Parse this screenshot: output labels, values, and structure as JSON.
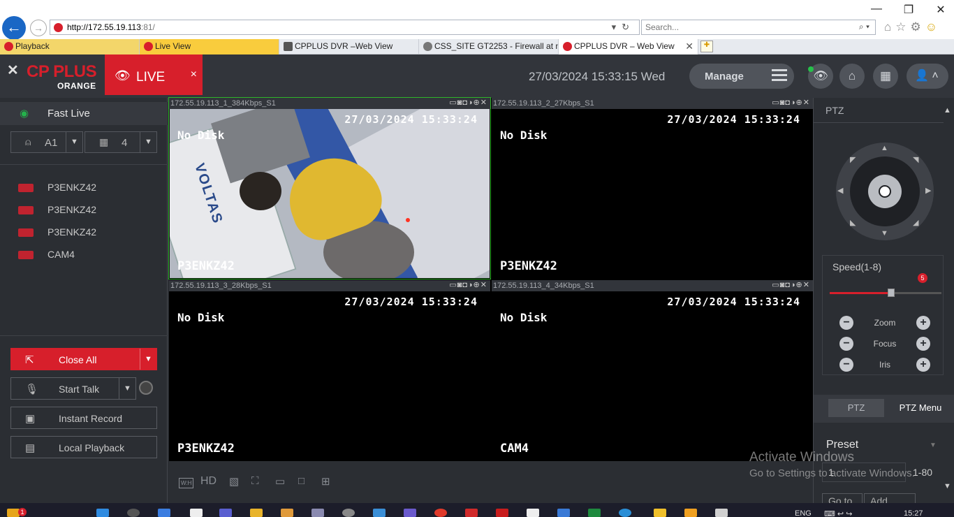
{
  "browser": {
    "url_host": "http://172.55.19.113",
    "url_rest": ":81/",
    "search_placeholder": "Search...",
    "tabs": [
      {
        "label": "Playback"
      },
      {
        "label": "Live View"
      },
      {
        "label": "CPPLUS DVR –Web View"
      },
      {
        "label": "CSS_SITE GT2253 - Firewall at n..."
      },
      {
        "label": "CPPLUS DVR – Web View"
      }
    ]
  },
  "header": {
    "brand_name": "CP PLUS",
    "brand_sub": "ORANGE",
    "live_label": "LIVE",
    "live_close": "×",
    "datetime": "27/03/2024 15:33:15 Wed",
    "manage_label": "Manage"
  },
  "sidebar": {
    "fast_live": "Fast Live",
    "area_select": "A1",
    "split_select": "4",
    "channels": [
      {
        "name": "P3ENKZ42"
      },
      {
        "name": "P3ENKZ42"
      },
      {
        "name": "P3ENKZ42"
      },
      {
        "name": "CAM4"
      }
    ],
    "close_all": "Close All",
    "start_talk": "Start Talk",
    "instant_record": "Instant Record",
    "local_playback": "Local Playback"
  },
  "video": {
    "panes": [
      {
        "title": "172.55.19.113_1_384Kbps_S1",
        "osd_time": "27/03/2024 15:33:24",
        "osd_status": "No Disk",
        "osd_name": "P3ENKZ42",
        "image_text": "VOLTAS"
      },
      {
        "title": "172.55.19.113_2_27Kbps_S1",
        "osd_time": "27/03/2024 15:33:24",
        "osd_status": "No Disk",
        "osd_name": "P3ENKZ42"
      },
      {
        "title": "172.55.19.113_3_28Kbps_S1",
        "osd_time": "27/03/2024 15:33:24",
        "osd_status": "No Disk",
        "osd_name": "P3ENKZ42"
      },
      {
        "title": "172.55.19.113_4_34Kbps_S1",
        "osd_time": "27/03/2024 15:33:24",
        "osd_status": "No Disk",
        "osd_name": "CAM4"
      }
    ]
  },
  "toolbar": {
    "wh_label": "W:H",
    "hd_label": "HD"
  },
  "ptz": {
    "title": "PTZ",
    "speed_label": "Speed(1-8)",
    "speed_value": "5",
    "speed_fraction": 0.5,
    "zoom_label": "Zoom",
    "focus_label": "Focus",
    "iris_label": "Iris",
    "tab_ptz": "PTZ",
    "tab_menu": "PTZ Menu",
    "preset_label": "Preset",
    "preset_value": "1",
    "preset_range": "1-80",
    "goto_label": "Go to",
    "add_label": "Add"
  },
  "watermark": {
    "line1": "Activate Windows",
    "line2": "Go to Settings to activate Windows."
  },
  "taskbar": {
    "lang": "ENG",
    "time": "15:27",
    "notification_count": "1"
  },
  "colors": {
    "brand_red": "#d71f2b",
    "active_green": "#2fb52a",
    "panel_dark": "#2b2e33"
  }
}
